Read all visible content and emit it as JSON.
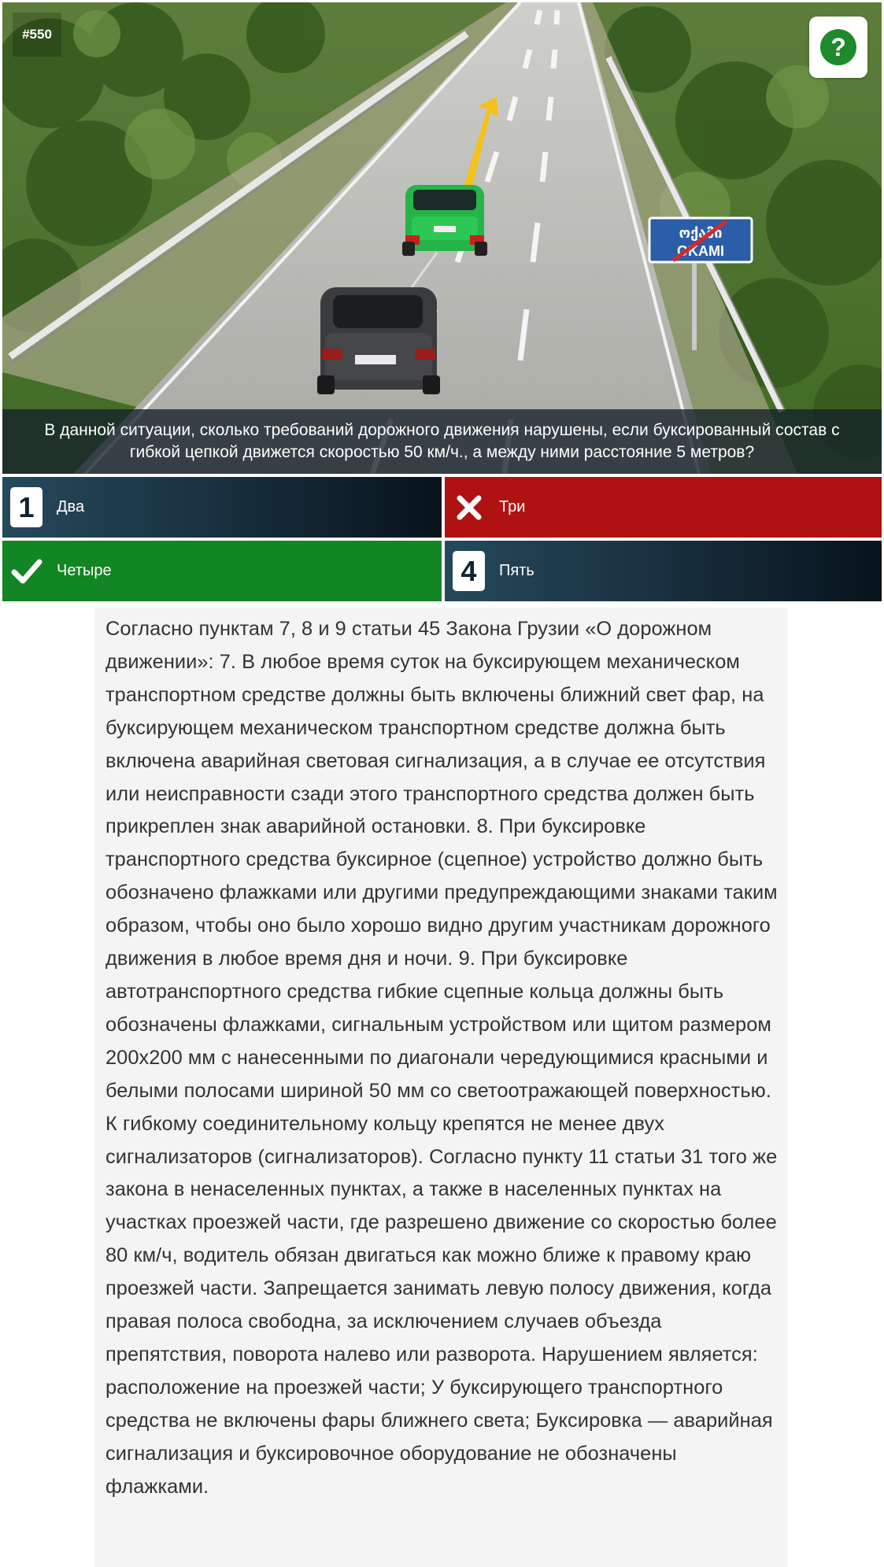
{
  "question": {
    "number": "#550",
    "text": "В данной ситуации, сколько требований дорожного движения нарушены, если буксированный состав с гибкой цепкой движется скоростью 50 км/ч., а между ними расстояние 5 метров?",
    "sign_text_top": "ოქამი",
    "sign_text_bottom": "OKAMI"
  },
  "help_button": {
    "label": "?"
  },
  "answers": [
    {
      "badge": "1",
      "label": "Два",
      "state": "neutral"
    },
    {
      "badge": "",
      "label": "Три",
      "state": "wrong",
      "icon": "cross-icon"
    },
    {
      "badge": "",
      "label": "Четыре",
      "state": "correct",
      "icon": "check-icon"
    },
    {
      "badge": "4",
      "label": "Пять",
      "state": "neutral"
    }
  ],
  "explanation": "Согласно пунктам 7, 8 и 9 статьи 45 Закона Грузии «О дорожном движении»: 7. В любое время суток на буксирующем механическом транспортном средстве должны быть включены ближний свет фар, на буксирующем механическом транспортном средстве должна быть включена аварийная световая сигнализация, а в случае ее отсутствия или неисправности сзади этого транспортного средства должен быть прикреплен знак аварийной остановки. 8. При буксировке транспортного средства буксирное (сцепное) устройство должно быть обозначено флажками или другими предупреждающими знаками таким образом, чтобы оно было хорошо видно другим участникам дорожного движения в любое время дня и ночи. 9. При буксировке автотранспортного средства гибкие сцепные кольца должны быть обозначены флажками, сигнальным устройством или щитом размером 200x200 мм с нанесенными по диагонали чередующимися красными и белыми полосами шириной 50 мм со светоотражающей поверхностью. К гибкому соединительному кольцу крепятся не менее двух сигнализаторов (сигнализаторов). Согласно пункту 11 статьи 31 того же закона в ненаселенных пунктах, а также в населенных пунктах на участках проезжей части, где разрешено движение со скоростью более 80 км/ч, водитель обязан двигаться как можно ближе к правому краю проезжей части. Запрещается занимать левую полосу движения, когда правая полоса свободна, за исключением случаев объезда препятствия, поворота налево или разворота. Нарушением является: расположение на проезжей части; У буксирующего транспортного средства не включены фары ближнего света; Буксировка — аварийная сигнализация и буксировочное оборудование не обозначены флажками."
}
